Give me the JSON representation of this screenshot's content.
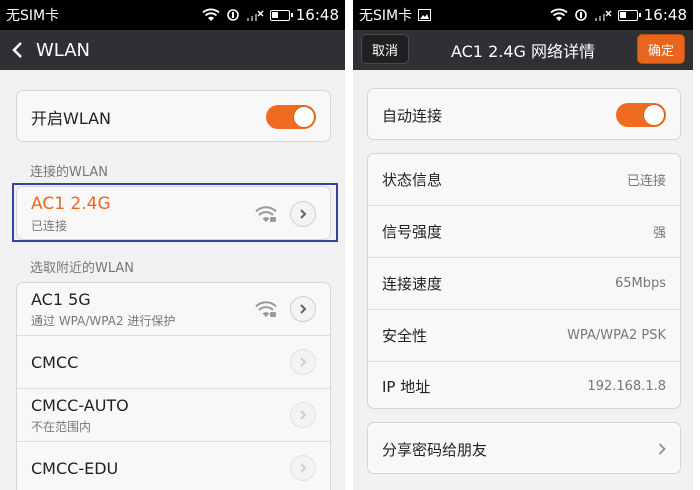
{
  "left": {
    "status": {
      "carrier": "无SIM卡",
      "time": "16:48"
    },
    "header": {
      "title": "WLAN"
    },
    "wlan_toggle": {
      "label": "开启WLAN",
      "on": true
    },
    "connected_section": "连接的WLAN",
    "connected": {
      "name": "AC1 2.4G",
      "status": "已连接"
    },
    "nearby_section": "选取附近的WLAN",
    "networks": [
      {
        "name": "AC1 5G",
        "sub": "通过 WPA/WPA2 进行保护",
        "icon": "wifi-lock-icon"
      },
      {
        "name": "CMCC",
        "sub": ""
      },
      {
        "name": "CMCC-AUTO",
        "sub": "不在范围内"
      },
      {
        "name": "CMCC-EDU",
        "sub": ""
      }
    ]
  },
  "right": {
    "status": {
      "carrier": "无SIM卡",
      "time": "16:48"
    },
    "header": {
      "title": "AC1 2.4G 网络详情",
      "cancel": "取消",
      "ok": "确定"
    },
    "auto_connect": {
      "label": "自动连接",
      "on": true
    },
    "details": [
      {
        "label": "状态信息",
        "value": "已连接"
      },
      {
        "label": "信号强度",
        "value": "强"
      },
      {
        "label": "连接速度",
        "value": "65Mbps"
      },
      {
        "label": "安全性",
        "value": "WPA/WPA2 PSK"
      },
      {
        "label": "IP 地址",
        "value": "192.168.1.8"
      }
    ],
    "share": {
      "label": "分享密码给朋友"
    }
  },
  "colors": {
    "accent": "#ef6b1f",
    "highlight": "#3a3fa2",
    "titlebar": "#2f3033"
  }
}
